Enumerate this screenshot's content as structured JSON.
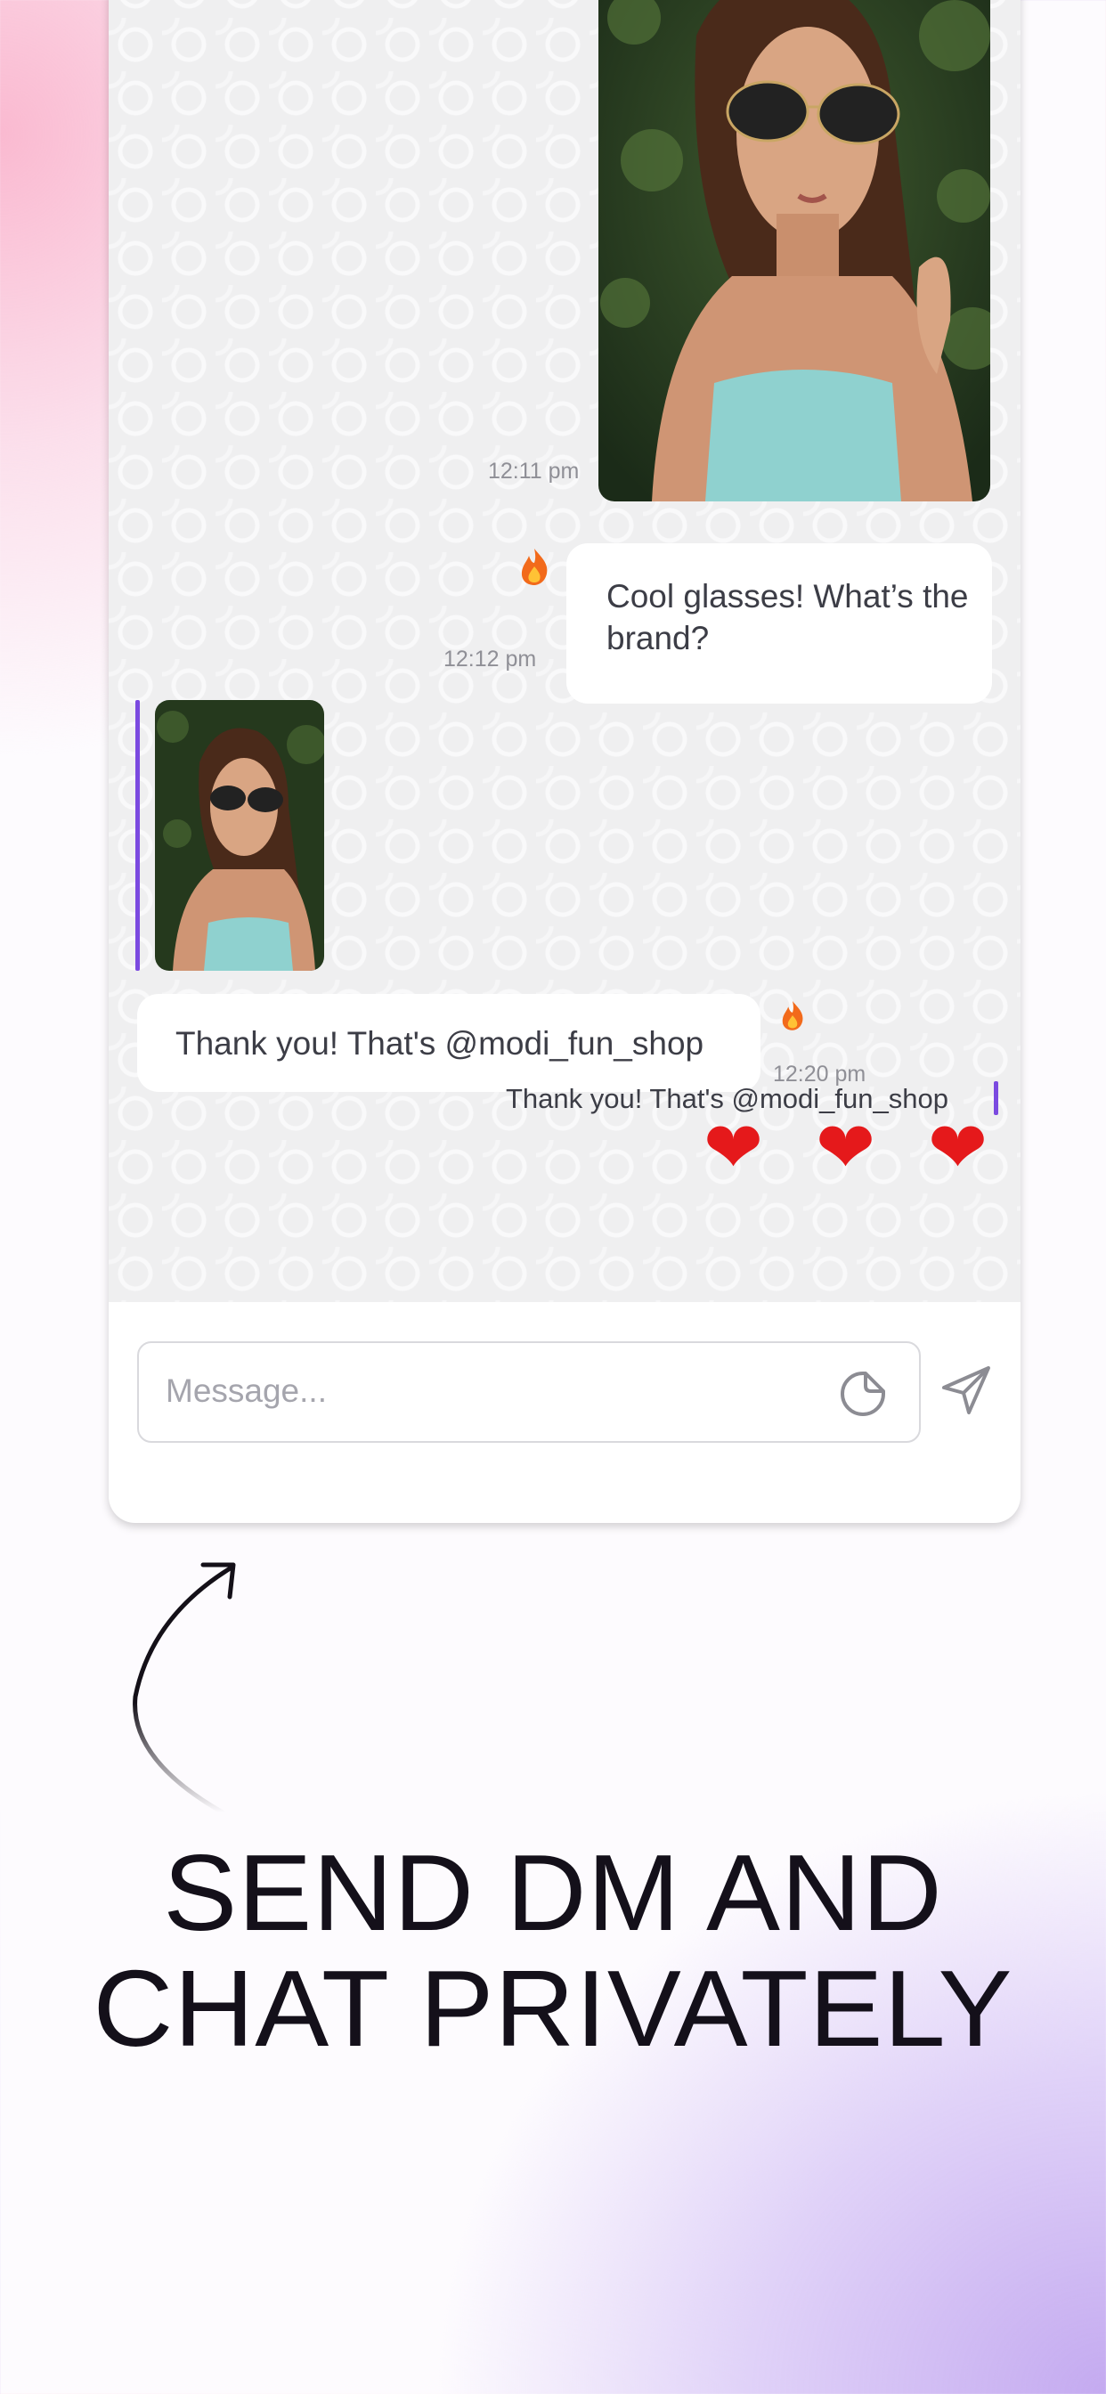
{
  "chat": {
    "messages": [
      {
        "type": "image",
        "direction": "outgoing",
        "time": "12:11 pm"
      },
      {
        "type": "text",
        "direction": "outgoing",
        "text": "Cool glasses! What’s the brand?",
        "time": "12:12 pm",
        "reaction_icon": "fire-icon"
      },
      {
        "type": "image",
        "direction": "incoming",
        "reply_thumbnail": true
      },
      {
        "type": "text",
        "direction": "incoming",
        "text": "Thank you! That's @modi_fun_shop",
        "time": "12:20 pm",
        "reaction_icon": "fire-icon"
      },
      {
        "type": "reply",
        "direction": "outgoing",
        "quote": "Thank you! That's @modi_fun_shop",
        "hearts": 3
      }
    ],
    "reply_bar_color": "#7b4ae0",
    "heart_color": "#e5191b"
  },
  "composer": {
    "placeholder": "Message...",
    "sticker_icon": "sticker-icon",
    "send_icon": "send-icon"
  },
  "promo": {
    "arrow_icon": "curved-arrow-icon",
    "headline_line1": "SEND DM AND",
    "headline_line2": "CHAT PRIVATELY"
  }
}
